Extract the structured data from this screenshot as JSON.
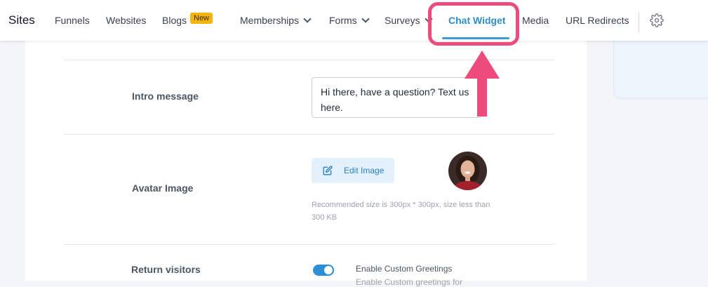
{
  "nav": {
    "title": "Sites",
    "items": [
      {
        "label": "Funnels"
      },
      {
        "label": "Websites"
      },
      {
        "label": "Blogs",
        "badge": "New"
      },
      {
        "label": "Memberships"
      },
      {
        "label": "Forms"
      },
      {
        "label": "Surveys"
      },
      {
        "label": "Chat Widget",
        "active": true
      },
      {
        "label": "Media"
      },
      {
        "label": "URL Redirects"
      }
    ],
    "settings_icon": "gear-icon"
  },
  "form": {
    "intro": {
      "label": "Intro message",
      "value": "Hi there, have a question? Text us here."
    },
    "avatar": {
      "label": "Avatar Image",
      "edit_button": "Edit Image",
      "hint": "Recommended size is 300px * 300px, size less than 300 KB"
    },
    "return_visitors": {
      "label": "Return visitors",
      "toggle_label": "Enable Custom Greetings",
      "toggle_on": true,
      "toggle_sub": "Enable Custom greetings for"
    }
  },
  "colors": {
    "accent": "#2b8fc7",
    "highlight": "#ec4c7b",
    "badge": "#f5b50a"
  }
}
